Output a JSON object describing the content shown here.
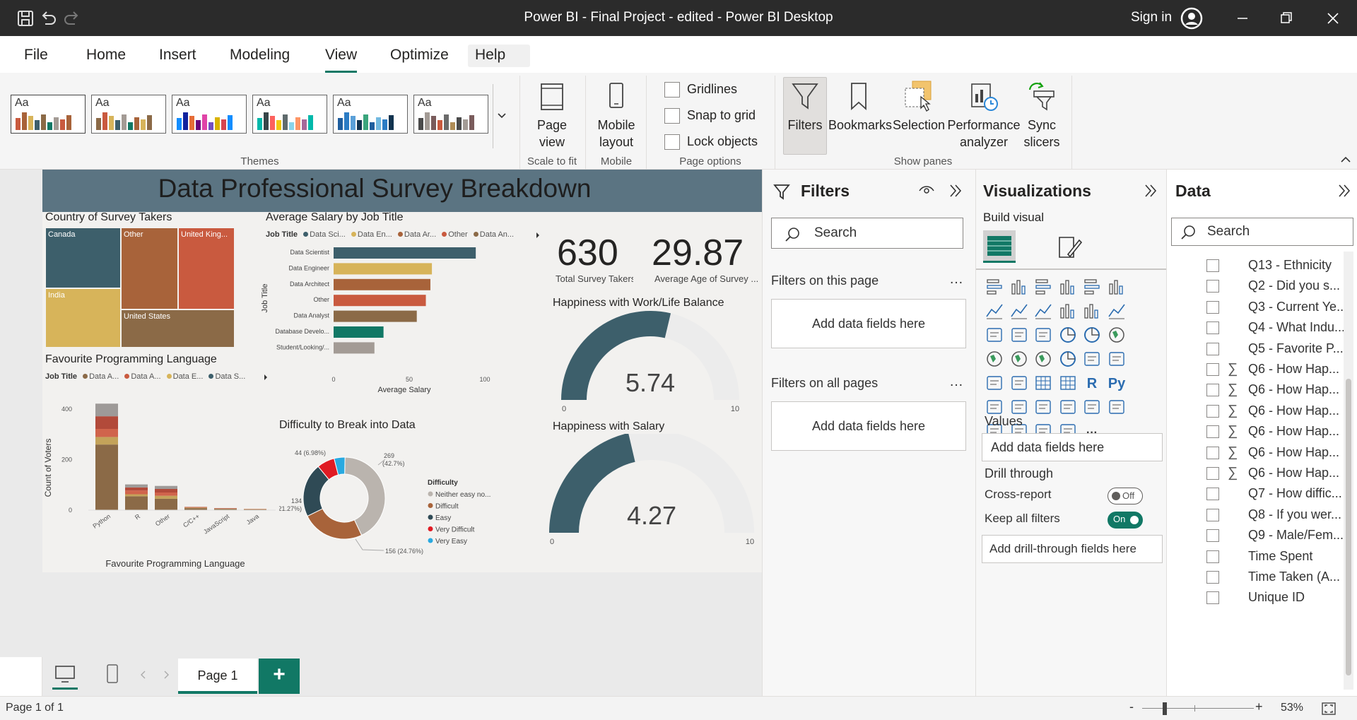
{
  "window": {
    "title": "Power BI - Final Project - edited - Power BI Desktop",
    "sign_in": "Sign in"
  },
  "ribbon_tabs": [
    "File",
    "Home",
    "Insert",
    "Modeling",
    "View",
    "Optimize",
    "Help"
  ],
  "active_tab": "View",
  "ribbon": {
    "themes_label": "Themes",
    "theme_tile_text": "Aa",
    "page_view": "Page view",
    "scale_to_fit": "Scale to fit",
    "mobile_layout": "Mobile layout",
    "mobile_label": "Mobile",
    "gridlines": "Gridlines",
    "snap_to_grid": "Snap to grid",
    "lock_objects": "Lock objects",
    "page_options": "Page options",
    "show_panes": [
      "Filters",
      "Bookmarks",
      "Selection",
      "Performance analyzer",
      "Sync slicers"
    ],
    "show_panes_label": "Show panes"
  },
  "report": {
    "title": "Data Professional Survey Breakdown",
    "treemap": {
      "title": "Country of Survey Takers",
      "tiles": [
        "Canada",
        "Other",
        "United King...",
        "India",
        "United States"
      ]
    },
    "salary_chart": {
      "title": "Average Salary by Job Title",
      "legend_title": "Job Title",
      "legend": [
        "Data Sci...",
        "Data En...",
        "Data Ar...",
        "Other",
        "Data An..."
      ],
      "axis_title_y": "Job Title",
      "axis_title_x": "Average Salary",
      "x_ticks": [
        "0",
        "50",
        "100"
      ]
    },
    "kpi_total": {
      "value": "630",
      "label": "Total Survey Takers"
    },
    "kpi_age": {
      "value": "29.87",
      "label": "Average Age of Survey ..."
    },
    "gauge_work": {
      "title": "Happiness with Work/Life Balance",
      "value": "5.74",
      "min": "0",
      "max": "10",
      "fraction": 0.574
    },
    "gauge_salary": {
      "title": "Happiness with Salary",
      "value": "4.27",
      "min": "0",
      "max": "10",
      "fraction": 0.427
    },
    "lang_chart": {
      "title": "Favourite Programming Language",
      "legend_title": "Job Title",
      "legend": [
        "Data A...",
        "Data A...",
        "Data E...",
        "Data S..."
      ],
      "ylabel": "Count of Voters",
      "xlabel": "Favourite Programming Language",
      "y_ticks": [
        "0",
        "200",
        "400"
      ]
    },
    "donut": {
      "title": "Difficulty to Break into Data",
      "legend_title": "Difficulty",
      "legend": [
        "Neither easy no...",
        "Difficult",
        "Easy",
        "Very Difficult",
        "Very Easy"
      ],
      "labels": [
        "269",
        "(42.7%)",
        "156 (24.76%)",
        "134",
        "(21.27%)",
        "44 (6.98%)"
      ]
    }
  },
  "chart_data": [
    {
      "type": "bar",
      "title": "Average Salary by Job Title",
      "xlabel": "Average Salary",
      "ylabel": "Job Title",
      "categories": [
        "Data Scientist",
        "Data Engineer",
        "Data Architect",
        "Other",
        "Data Analyst",
        "Database Develo...",
        "Student/Looking/..."
      ],
      "values": [
        94,
        65,
        64,
        61,
        55,
        33,
        27
      ],
      "colors": [
        "#3d5f6b",
        "#d7b45a",
        "#a8633a",
        "#c95a3f",
        "#8b6a47",
        "#117865",
        "#a39b95"
      ],
      "xlim": [
        0,
        100
      ]
    },
    {
      "type": "bar",
      "title": "Favourite Programming Language",
      "xlabel": "Favourite Programming Language",
      "ylabel": "Count of Voters",
      "categories": [
        "Python",
        "R",
        "Other",
        "C/C++",
        "JavaScript",
        "Java"
      ],
      "series": [
        {
          "name": "Data A...",
          "values": [
            260,
            55,
            45,
            8,
            5,
            3
          ]
        },
        {
          "name": "Data A...",
          "values": [
            30,
            8,
            12,
            2,
            1,
            1
          ]
        },
        {
          "name": "Data E...",
          "values": [
            32,
            15,
            13,
            2,
            1,
            1
          ]
        },
        {
          "name": "Data S...",
          "values": [
            50,
            12,
            14,
            1,
            1,
            0
          ]
        },
        {
          "name": "",
          "values": [
            50,
            12,
            12,
            0,
            0,
            0
          ]
        }
      ],
      "colors": [
        "#8b6a47",
        "#c4a35a",
        "#d0644c",
        "#b24a3a",
        "#9e9a98"
      ],
      "ylim": [
        0,
        420
      ]
    },
    {
      "type": "pie",
      "title": "Difficulty to Break into Data",
      "categories": [
        "Neither easy nor difficult",
        "Difficult",
        "Easy",
        "Very Difficult",
        "Very Easy"
      ],
      "values": [
        269,
        156,
        134,
        44,
        27
      ],
      "colors": [
        "#bab4ae",
        "#a8633a",
        "#2f4a55",
        "#e01b24",
        "#29a9e0"
      ]
    }
  ],
  "pages": {
    "current": "Page 1",
    "status": "Page 1 of 1",
    "zoom": "53%"
  },
  "filters": {
    "title": "Filters",
    "search": "Search",
    "on_this_page": "Filters on this page",
    "on_all_pages": "Filters on all pages",
    "add_fields": "Add data fields here",
    "more": "…"
  },
  "visualizations": {
    "title": "Visualizations",
    "build_visual": "Build visual",
    "values": "Values",
    "add_fields": "Add data fields here",
    "drill_through": "Drill through",
    "cross_report": "Cross-report",
    "cross_report_state": "Off",
    "keep_all_filters": "Keep all filters",
    "keep_all_filters_state": "On",
    "add_drill": "Add drill-through fields here",
    "more": "···",
    "r_glyph": "R",
    "py_glyph": "Py"
  },
  "data_pane": {
    "title": "Data",
    "search": "Search",
    "fields": [
      {
        "name": "Q13 - Ethnicity",
        "sigma": false
      },
      {
        "name": "Q2 - Did you s...",
        "sigma": false
      },
      {
        "name": "Q3 - Current Ye...",
        "sigma": false
      },
      {
        "name": "Q4 - What Indu...",
        "sigma": false
      },
      {
        "name": "Q5 - Favorite P...",
        "sigma": false
      },
      {
        "name": "Q6 - How Hap...",
        "sigma": true
      },
      {
        "name": "Q6 - How Hap...",
        "sigma": true
      },
      {
        "name": "Q6 - How Hap...",
        "sigma": true
      },
      {
        "name": "Q6 - How Hap...",
        "sigma": true
      },
      {
        "name": "Q6 - How Hap...",
        "sigma": true
      },
      {
        "name": "Q6 - How Hap...",
        "sigma": true
      },
      {
        "name": "Q7 - How diffic...",
        "sigma": false
      },
      {
        "name": "Q8 - If you wer...",
        "sigma": false
      },
      {
        "name": "Q9 - Male/Fem...",
        "sigma": false
      },
      {
        "name": "Time Spent",
        "sigma": false
      },
      {
        "name": "Time Taken (A...",
        "sigma": false
      },
      {
        "name": "Unique ID",
        "sigma": false
      }
    ],
    "sigma_glyph": "∑"
  }
}
